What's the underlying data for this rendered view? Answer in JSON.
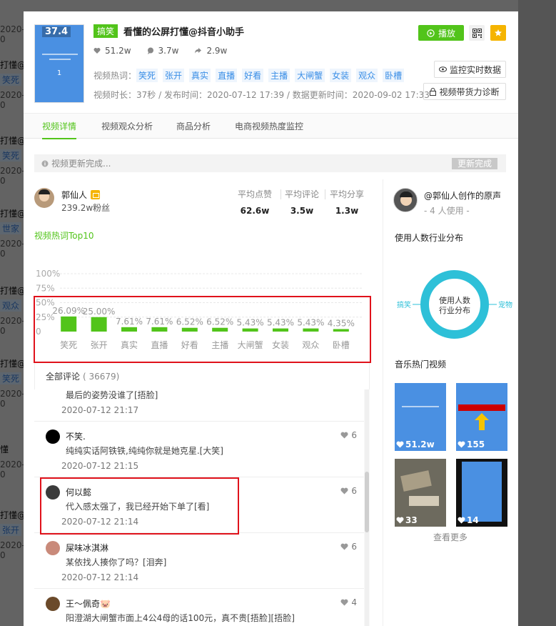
{
  "backdrop": {
    "rows": [
      {
        "title": "",
        "tag": "",
        "date": "2020-0"
      },
      {
        "title": "打懂@",
        "tag": "笑死",
        "date": "2020-0"
      },
      {
        "title": "打懂@",
        "tag": "笑死",
        "date": "2020-0"
      },
      {
        "title": "打懂@",
        "tag": "世家",
        "date": "2020-0"
      },
      {
        "title": "打懂@",
        "tag": "观众",
        "date": "2020-0"
      },
      {
        "title": "打懂@",
        "tag": "笑死",
        "date": "2020-0"
      },
      {
        "title": "懂",
        "tag": "",
        "date": "2020-0"
      },
      {
        "title": "打懂@",
        "tag": "张开",
        "date": "2020-0"
      }
    ]
  },
  "video": {
    "score": "37.4",
    "cover_num": "1",
    "category": "搞笑",
    "title": "看懂的公屏打懂@抖音小助手",
    "likes": "51.2w",
    "comments": "3.7w",
    "shares": "2.9w",
    "hotwords_label": "视频热词：",
    "hotwords": [
      "笑死",
      "张开",
      "真实",
      "直播",
      "好看",
      "主播",
      "大闸蟹",
      "女装",
      "观众",
      "卧槽"
    ],
    "meta": "视频时长：37秒 / 发布时间：2020-07-12 17:39 / 数据更新时间：2020-09-02 17:33"
  },
  "actions": {
    "play": "播放",
    "monitor": "监控实时数据",
    "diagnose": "视频带货力诊断"
  },
  "tabs": [
    "视频详情",
    "视频观众分析",
    "商品分析",
    "电商视频热度监控"
  ],
  "notice": {
    "text": "视频更新完成...",
    "done": "更新完成"
  },
  "author": {
    "name": "郭仙人",
    "fans": "239.2w粉丝",
    "avg_likes_label": "平均点赞",
    "avg_likes": "62.6w",
    "avg_comments_label": "平均评论",
    "avg_comments": "3.5w",
    "avg_shares_label": "平均分享",
    "avg_shares": "1.3w"
  },
  "chart_title": "视频热词Top10",
  "chart_data": {
    "type": "bar",
    "categories": [
      "笑死",
      "张开",
      "真实",
      "直播",
      "好看",
      "主播",
      "大闸蟹",
      "女装",
      "观众",
      "卧槽"
    ],
    "values": [
      26.09,
      25.0,
      7.61,
      7.61,
      6.52,
      6.52,
      5.43,
      5.43,
      5.43,
      4.35
    ],
    "data_labels": [
      "26.09%",
      "25.00%",
      "7.61%",
      "7.61%",
      "6.52%",
      "6.52%",
      "5.43%",
      "5.43%",
      "5.43%",
      "4.35%"
    ],
    "yticks": [
      "100%",
      "75%",
      "50%",
      "25%",
      "0"
    ],
    "ylim": [
      0,
      100
    ],
    "grid": true,
    "color": "#52c41a"
  },
  "comments": {
    "label": "全部评论",
    "count": "( 36679)",
    "items": [
      {
        "name": "",
        "text": "最后的姿势没谁了[捂脸]",
        "time": "2020-07-12 21:17",
        "likes": "",
        "avatar_color": "#222222"
      },
      {
        "name": "不笑.",
        "text": "纯纯实话阿铁铁,纯纯你就是她克星.[大笑]",
        "time": "2020-07-12 21:15",
        "likes": "6",
        "avatar_color": "#000000"
      },
      {
        "name": "何以懿",
        "text": "代入感太强了，我已经开始下单了[看]",
        "time": "2020-07-12 21:14",
        "likes": "6",
        "avatar_color": "#3b3b3b"
      },
      {
        "name": "屎味冰淇淋",
        "text": "某依找人揍你了吗？[泪奔]",
        "time": "2020-07-12 21:14",
        "likes": "6",
        "avatar_color": "#c98a7a"
      },
      {
        "name": "王～佩奇🐷",
        "text": "阳澄湖大闸蟹市面上4公4母的话100元，真不贵[捂脸][捂脸]",
        "time": "",
        "likes": "4",
        "avatar_color": "#6b4a2a"
      }
    ]
  },
  "right": {
    "owner": "@郭仙人创作的原声",
    "users": "- 4 人使用 -",
    "industry_title": "使用人数行业分布",
    "donut_center": [
      "使用人数",
      "行业分布"
    ],
    "donut_left": "搞笑",
    "donut_right": "宠物",
    "music_title": "音乐热门视频",
    "videos": [
      {
        "count": "51.2w",
        "bg": "#4a90e2"
      },
      {
        "count": "155",
        "bg": "#4a90e2"
      },
      {
        "count": "33",
        "bg": "#6d6a5e"
      },
      {
        "count": "14",
        "bg": "#111111"
      }
    ],
    "more": "查看更多",
    "colors": {
      "donut": "#2ec0d8",
      "accent": "#52c41a"
    }
  }
}
